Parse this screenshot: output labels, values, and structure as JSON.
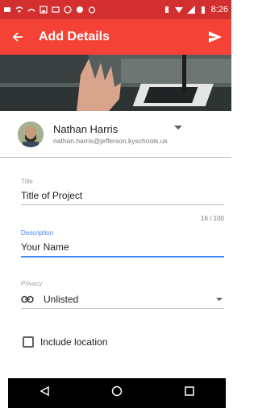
{
  "status_bar": {
    "time": "8:26"
  },
  "app_bar": {
    "title": "Add Details"
  },
  "account": {
    "name": "Nathan Harris",
    "email": "nathan.harris@jefferson.kyschools.us"
  },
  "form": {
    "title_label": "Title",
    "title_value": "Title of Project",
    "char_counter": "16 / 100",
    "description_label": "Description",
    "description_value": "Your Name",
    "privacy_label": "Privacy",
    "privacy_value": "Unlisted",
    "location_label": "Include location",
    "location_checked": false
  },
  "colors": {
    "status_bar": "#d32f2f",
    "app_bar": "#f44336",
    "accent": "#4285f4"
  }
}
